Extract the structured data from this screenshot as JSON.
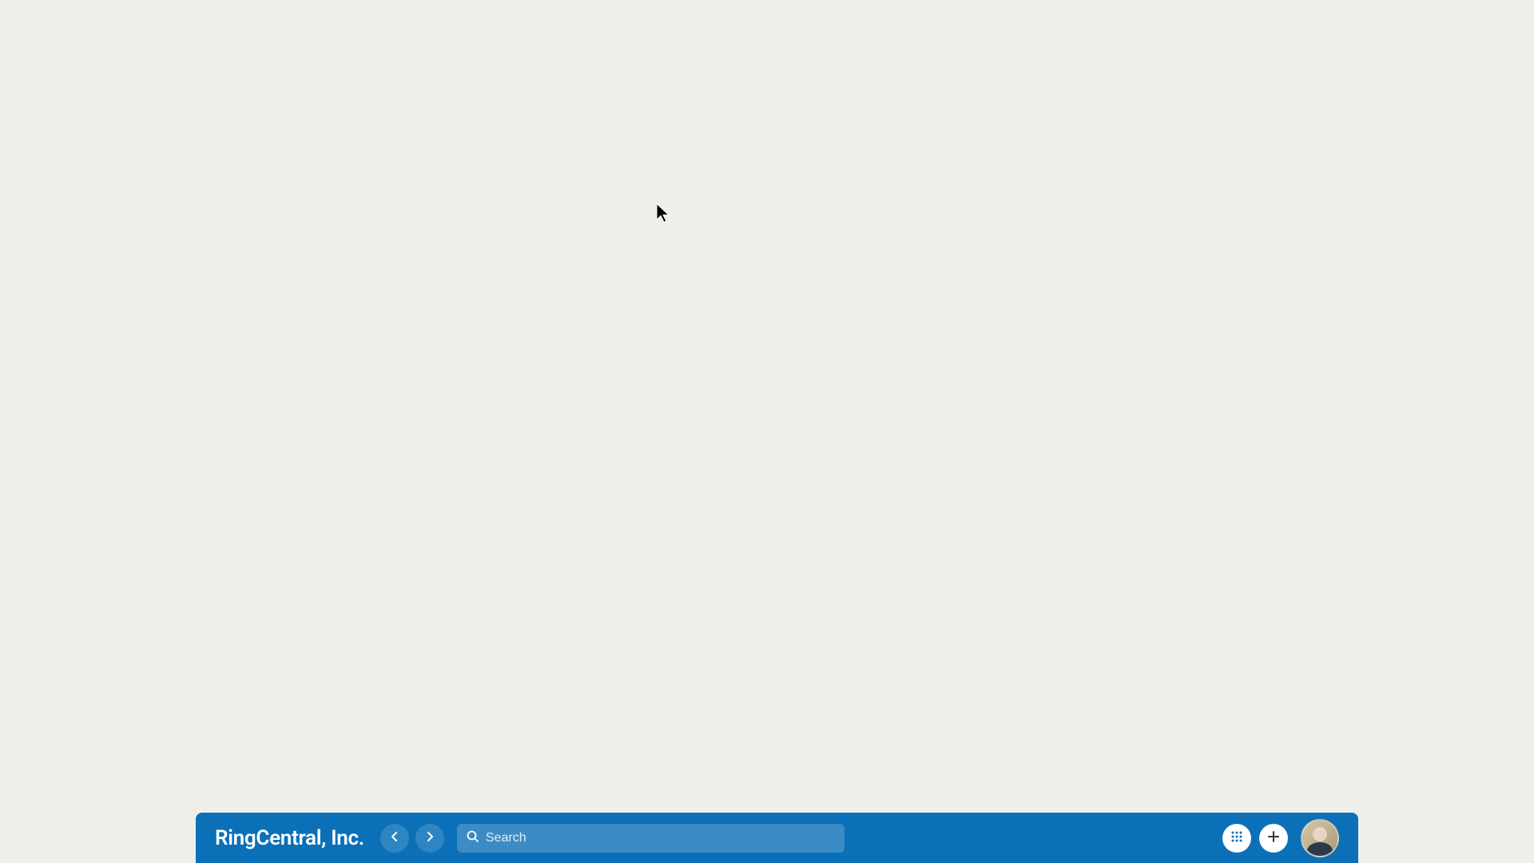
{
  "toolbar": {
    "brand_name": "RingCentral, Inc.",
    "search": {
      "placeholder": "Search",
      "value": ""
    }
  },
  "colors": {
    "background": "#f0eeea",
    "toolbar_bg": "#0b70b7",
    "toolbar_text": "#ffffff"
  }
}
